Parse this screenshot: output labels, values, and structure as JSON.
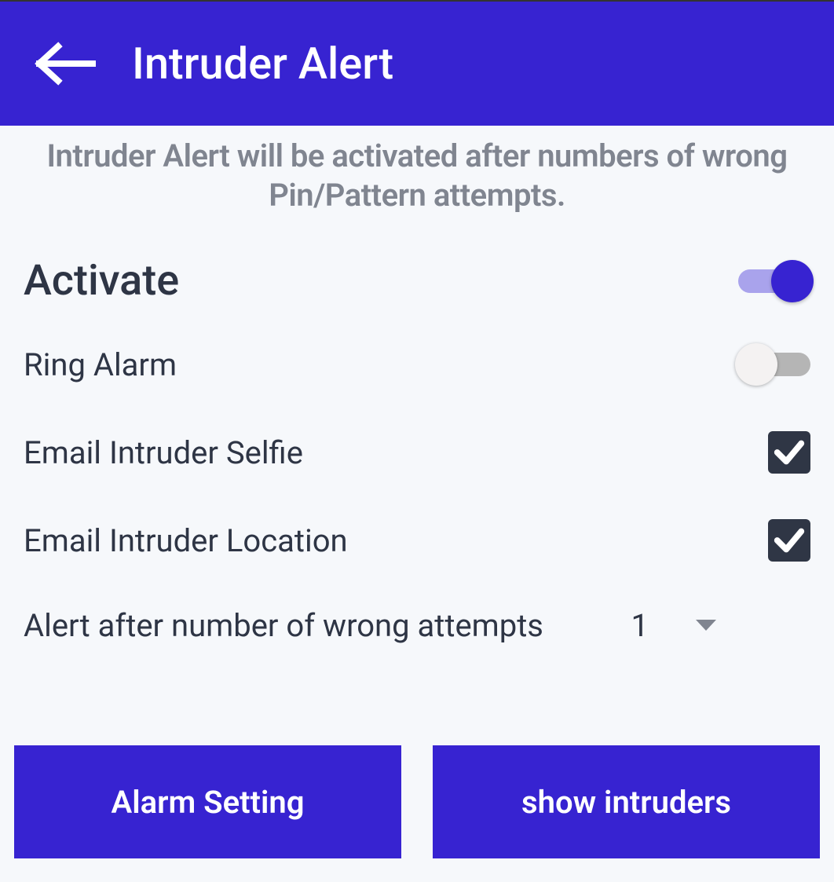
{
  "header": {
    "title": "Intruder Alert"
  },
  "description": "Intruder Alert will be activated after numbers of wrong Pin/Pattern attempts.",
  "settings": {
    "activate": {
      "label": "Activate",
      "value": true
    },
    "ring_alarm": {
      "label": "Ring Alarm",
      "value": false
    },
    "email_selfie": {
      "label": "Email Intruder Selfie",
      "value": true
    },
    "email_location": {
      "label": "Email Intruder Location",
      "value": true
    },
    "attempts": {
      "label": "Alert after number of wrong attempts",
      "value": "1"
    }
  },
  "buttons": {
    "alarm_setting": "Alarm Setting",
    "show_intruders": "show intruders"
  },
  "colors": {
    "primary": "#3723d1",
    "checkbox": "#2f3645"
  }
}
